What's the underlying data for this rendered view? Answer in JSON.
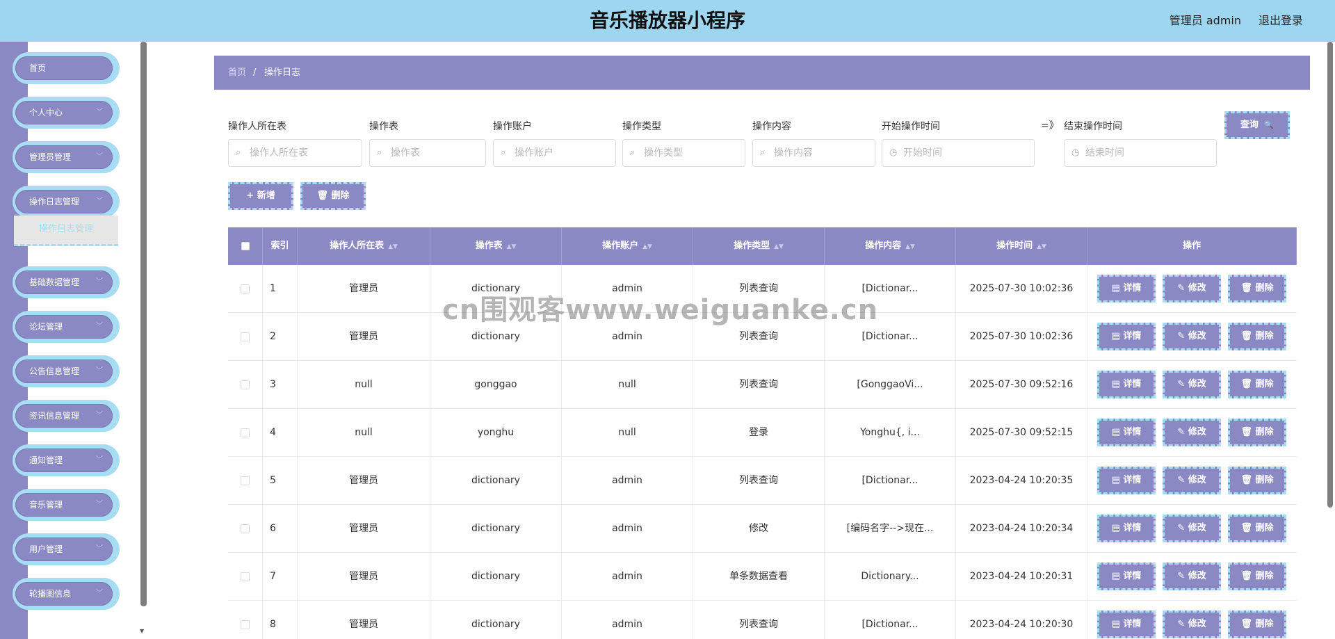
{
  "header": {
    "title": "音乐播放器小程序",
    "user": "管理员 admin",
    "logout": "退出登录"
  },
  "menu": {
    "items": [
      {
        "label": "首页",
        "chevron": ""
      },
      {
        "label": "个人中心",
        "chevron": "﹀"
      },
      {
        "label": "管理员管理",
        "chevron": "﹀"
      },
      {
        "label": "操作日志管理",
        "chevron": "﹀"
      },
      {
        "label": "基础数据管理",
        "chevron": "﹀"
      },
      {
        "label": "论坛管理",
        "chevron": "﹀"
      },
      {
        "label": "公告信息管理",
        "chevron": "﹀"
      },
      {
        "label": "资讯信息管理",
        "chevron": "﹀"
      },
      {
        "label": "通知管理",
        "chevron": "﹀"
      },
      {
        "label": "音乐管理",
        "chevron": "﹀"
      },
      {
        "label": "用户管理",
        "chevron": "﹀"
      },
      {
        "label": "轮播图信息",
        "chevron": "﹀"
      }
    ],
    "submenu": {
      "label": "操作日志管理"
    }
  },
  "breadcrumb": {
    "home": "首页",
    "sep": "/",
    "current": "操作日志"
  },
  "search": {
    "fields": [
      {
        "label": "操作人所在表",
        "placeholder": "操作人所在表",
        "icon": "search-icon"
      },
      {
        "label": "操作表",
        "placeholder": "操作表",
        "icon": "search-icon"
      },
      {
        "label": "操作账户",
        "placeholder": "操作账户",
        "icon": "search-icon"
      },
      {
        "label": "操作类型",
        "placeholder": "操作类型",
        "icon": "search-icon"
      },
      {
        "label": "操作内容",
        "placeholder": "操作内容",
        "icon": "search-icon"
      },
      {
        "label": "开始操作时间",
        "placeholder": "开始时间",
        "icon": "clock-icon"
      },
      {
        "label": "结束操作时间",
        "placeholder": "结束时间",
        "icon": "clock-icon"
      }
    ],
    "range_sep": "=》",
    "query_label": "查询",
    "query_icon": "🔍"
  },
  "toolbar": {
    "add_label": "+ 新增",
    "delete_label": "🗑 删除"
  },
  "table": {
    "columns": [
      "索引",
      "操作人所在表",
      "操作表",
      "操作账户",
      "操作类型",
      "操作内容",
      "操作时间",
      "操作"
    ],
    "sort_icon": "▲▼",
    "rows": [
      {
        "index": "1",
        "owner_table": "管理员",
        "op_table": "dictionary",
        "account": "admin",
        "type": "列表查询",
        "content": "[Dictionar...",
        "time": "2025-07-30 10:02:36"
      },
      {
        "index": "2",
        "owner_table": "管理员",
        "op_table": "dictionary",
        "account": "admin",
        "type": "列表查询",
        "content": "[Dictionar...",
        "time": "2025-07-30 10:02:36"
      },
      {
        "index": "3",
        "owner_table": "null",
        "op_table": "gonggao",
        "account": "null",
        "type": "列表查询",
        "content": "[GonggaoVi...",
        "time": "2025-07-30 09:52:16"
      },
      {
        "index": "4",
        "owner_table": "null",
        "op_table": "yonghu",
        "account": "null",
        "type": "登录",
        "content": "Yonghu{, i...",
        "time": "2025-07-30 09:52:15"
      },
      {
        "index": "5",
        "owner_table": "管理员",
        "op_table": "dictionary",
        "account": "admin",
        "type": "列表查询",
        "content": "[Dictionar...",
        "time": "2023-04-24 10:20:35"
      },
      {
        "index": "6",
        "owner_table": "管理员",
        "op_table": "dictionary",
        "account": "admin",
        "type": "修改",
        "content": "[编码名字-->现在...",
        "time": "2023-04-24 10:20:34"
      },
      {
        "index": "7",
        "owner_table": "管理员",
        "op_table": "dictionary",
        "account": "admin",
        "type": "单条数据查看",
        "content": "Dictionary...",
        "time": "2023-04-24 10:20:31"
      },
      {
        "index": "8",
        "owner_table": "管理员",
        "op_table": "dictionary",
        "account": "admin",
        "type": "列表查询",
        "content": "[Dictionar...",
        "time": "2023-04-24 10:20:30"
      }
    ],
    "actions": {
      "detail": "▤ 详情",
      "edit": "✎ 修改",
      "delete": "🗑 删除"
    }
  },
  "watermark": "cn围观客www.weiguanke.cn",
  "colors": {
    "header_bg": "#9fd6ef",
    "accent": "#8b89c4",
    "accent_border": "#a8dcf2"
  }
}
